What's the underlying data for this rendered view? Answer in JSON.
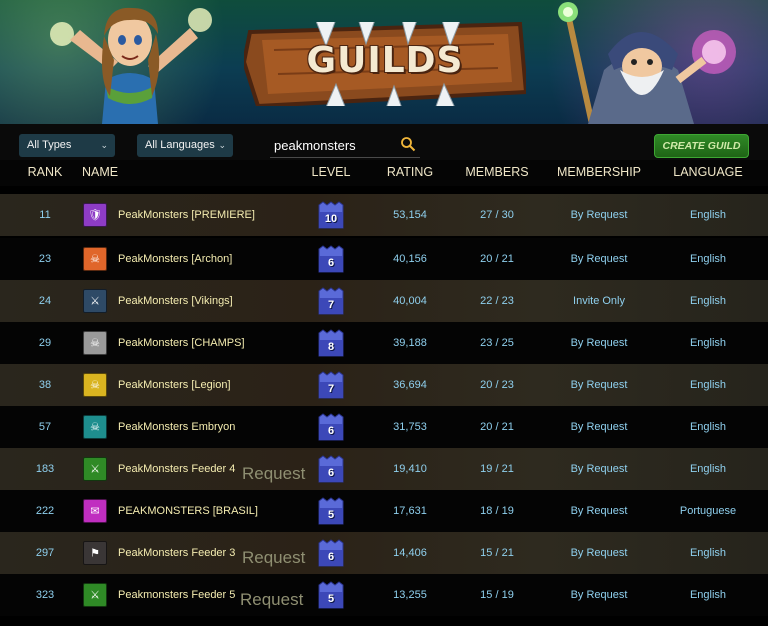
{
  "banner": {
    "title": "GUILDS"
  },
  "toolbar": {
    "type_filter": "All Types",
    "language_filter": "All Languages",
    "search_value": "peakmonsters",
    "create_label": "CREATE GUILD"
  },
  "columns": {
    "rank": "RANK",
    "name": "NAME",
    "level": "LEVEL",
    "rating": "RATING",
    "members": "MEMBERS",
    "membership": "MEMBERSHIP",
    "language": "LANGUAGE"
  },
  "colors": {
    "accent_green": "#2f8a26",
    "header_text": "#f0e7c8",
    "name_text": "#f4ecb0",
    "value_text": "#8fd0ee"
  },
  "guilds": [
    {
      "rank": "11",
      "name": "PeakMonsters [PREMIERE]",
      "level": "10",
      "rating": "53,154",
      "members": "27 / 30",
      "membership": "By Request",
      "language": "English",
      "emblem": "purple-shield-icon",
      "emblem_color": "#8e3cc6",
      "request": ""
    },
    {
      "rank": "23",
      "name": "PeakMonsters [Archon]",
      "level": "6",
      "rating": "40,156",
      "members": "20 / 21",
      "membership": "By Request",
      "language": "English",
      "emblem": "orange-skull-icon",
      "emblem_color": "#e0662a",
      "request": ""
    },
    {
      "rank": "24",
      "name": "PeakMonsters [Vikings]",
      "level": "7",
      "rating": "40,004",
      "members": "22 / 23",
      "membership": "Invite Only",
      "language": "English",
      "emblem": "blue-sword-icon",
      "emblem_color": "#2e4a66",
      "request": ""
    },
    {
      "rank": "29",
      "name": "PeakMonsters [CHAMPS]",
      "level": "8",
      "rating": "39,188",
      "members": "23 / 25",
      "membership": "By Request",
      "language": "English",
      "emblem": "gray-skull-icon",
      "emblem_color": "#9a9a9a",
      "request": ""
    },
    {
      "rank": "38",
      "name": "PeakMonsters [Legion]",
      "level": "7",
      "rating": "36,694",
      "members": "20 / 23",
      "membership": "By Request",
      "language": "English",
      "emblem": "gold-skull-icon",
      "emblem_color": "#d9b420",
      "request": ""
    },
    {
      "rank": "57",
      "name": "PeakMonsters Embryon",
      "level": "6",
      "rating": "31,753",
      "members": "20 / 21",
      "membership": "By Request",
      "language": "English",
      "emblem": "teal-skull-icon",
      "emblem_color": "#1e8e8e",
      "request": ""
    },
    {
      "rank": "183",
      "name": "PeakMonsters Feeder 4",
      "level": "6",
      "rating": "19,410",
      "members": "19 / 21",
      "membership": "By Request",
      "language": "English",
      "emblem": "green-sword-icon",
      "emblem_color": "#2f8a26",
      "request": "Request"
    },
    {
      "rank": "222",
      "name": "PEAKMONSTERS [BRASIL]",
      "level": "5",
      "rating": "17,631",
      "members": "18 / 19",
      "membership": "By Request",
      "language": "Portuguese",
      "emblem": "magenta-scroll-icon",
      "emblem_color": "#c02ec0",
      "request": ""
    },
    {
      "rank": "297",
      "name": "PeakMonsters Feeder 3",
      "level": "6",
      "rating": "14,406",
      "members": "15 / 21",
      "membership": "By Request",
      "language": "English",
      "emblem": "dark-banner-icon",
      "emblem_color": "#3a3636",
      "request": "Request"
    },
    {
      "rank": "323",
      "name": "Peakmonsters Feeder 5",
      "level": "5",
      "rating": "13,255",
      "members": "15 / 19",
      "membership": "By Request",
      "language": "English",
      "emblem": "green-sword-icon",
      "emblem_color": "#2f8a26",
      "request": "Request"
    }
  ]
}
